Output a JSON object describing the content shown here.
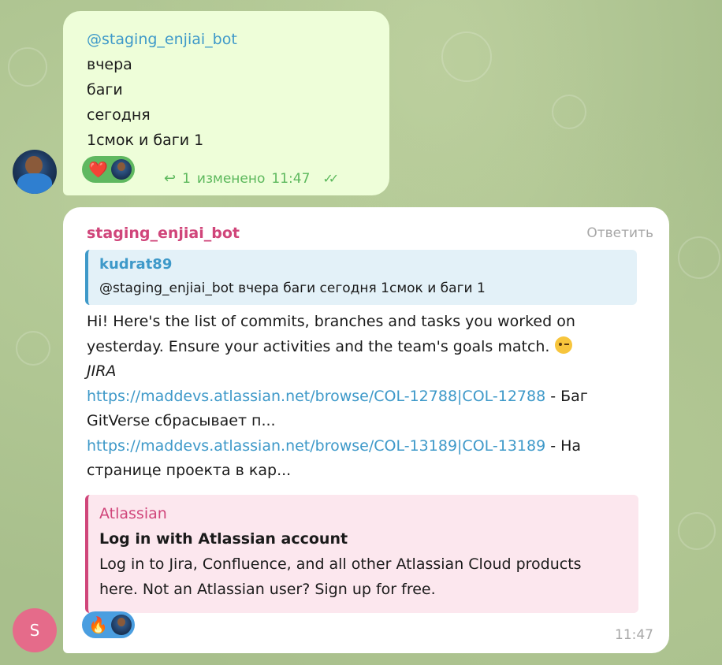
{
  "outgoing": {
    "lines": [
      "@staging_enjiai_bot",
      "вчера",
      "баги",
      "сегодня",
      "1смок и баги 1"
    ],
    "reaction_emoji": "❤️",
    "reply_count": "1",
    "edited_label": "изменено",
    "time": "11:47"
  },
  "incoming": {
    "sender": "staging_enjiai_bot",
    "reply_label": "Ответить",
    "quote": {
      "author": "kudrat89",
      "text": "@staging_enjiai_bot  вчера баги сегодня 1смок и баги 1"
    },
    "body": {
      "line1": "Hi! Here's the list of commits, branches and tasks you worked on",
      "line2": "yesterday. Ensure your activities and the team's goals match.",
      "section": "JIRA",
      "task1_link": "https://maddevs.atlassian.net/browse/COL-12788|COL-12788",
      "task1_suffix": " - Баг",
      "task1_cont": "GitVerse сбрасывает п...",
      "task2_link": "https://maddevs.atlassian.net/browse/COL-13189|COL-13189",
      "task2_suffix": " - На",
      "task2_cont": "странице проекта в кар..."
    },
    "preview": {
      "site": "Atlassian",
      "title": "Log in with Atlassian account",
      "desc_line1": "Log in to Jira, Confluence, and all other Atlassian Cloud products",
      "desc_line2": "here. Not an Atlassian user? Sign up for free."
    },
    "reaction_emoji": "🔥",
    "time": "11:47",
    "avatar_letter": "S"
  },
  "colors": {
    "outgoing_bubble": "#eefed9",
    "incoming_bubble": "#ffffff",
    "link": "#3e99c9",
    "sender": "#d0457a",
    "meta_green": "#5cb85c"
  }
}
